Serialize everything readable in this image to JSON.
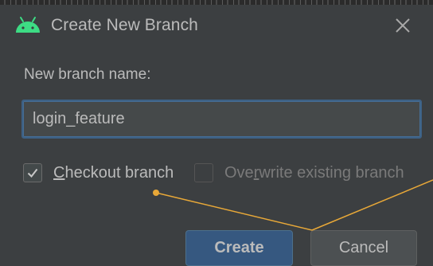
{
  "dialog": {
    "title": "Create New Branch",
    "app_icon": "android-icon",
    "close_icon": "close-icon"
  },
  "form": {
    "name_label": "New branch name:",
    "name_value": "login_feature",
    "checkout": {
      "pre": "",
      "mnemonic": "C",
      "post": "heckout branch",
      "checked": true
    },
    "overwrite": {
      "pre": "Ove",
      "mnemonic": "r",
      "post": "write existing branch",
      "checked": false,
      "enabled": false
    }
  },
  "buttons": {
    "create_label": "Create",
    "cancel_label": "Cancel"
  },
  "colors": {
    "background": "#3c3f41",
    "accent": "#365880",
    "android_green": "#3ddc84",
    "annotation": "#e8a838"
  }
}
